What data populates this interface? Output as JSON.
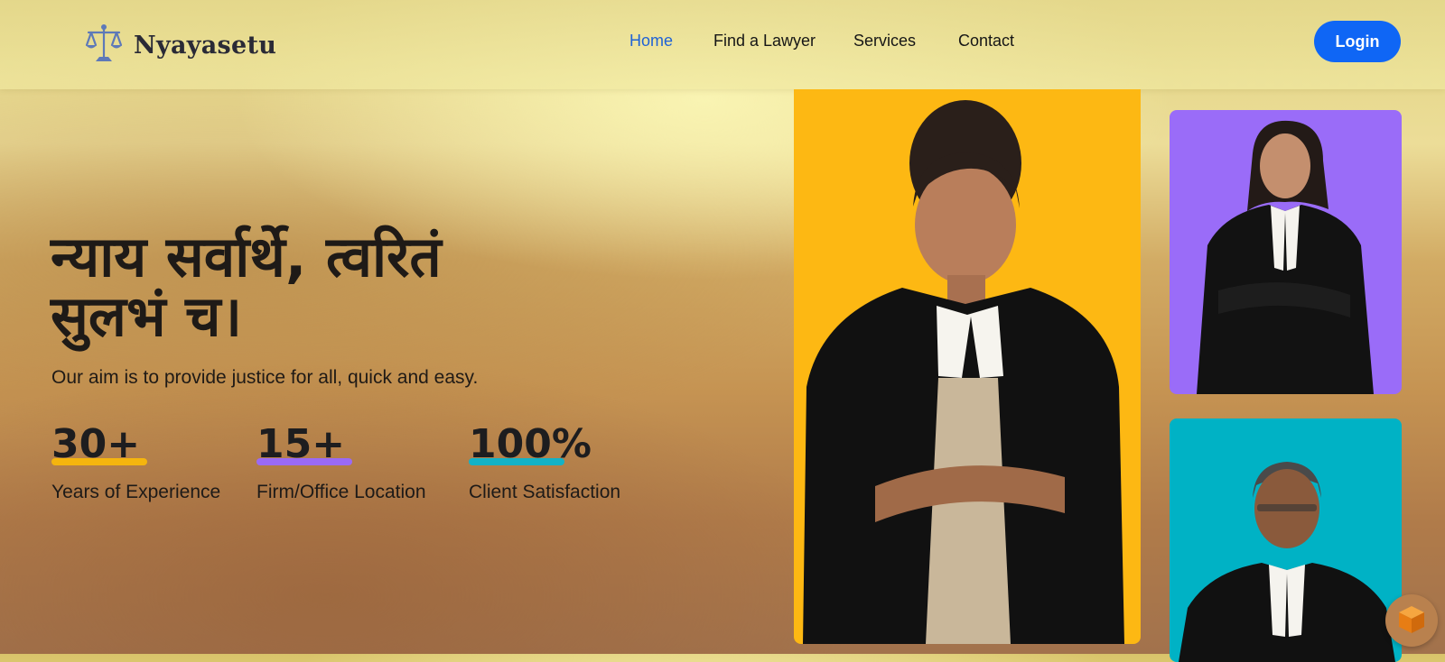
{
  "brand": {
    "name": "Nyayasetu",
    "logo_icon": "scales-of-justice-icon"
  },
  "nav": {
    "links": [
      {
        "label": "Home",
        "active": true
      },
      {
        "label": "Find a Lawyer",
        "active": false
      },
      {
        "label": "Services",
        "active": false
      },
      {
        "label": "Contact",
        "active": false
      }
    ],
    "login_label": "Login"
  },
  "hero": {
    "title_line1": "न्याय सर्वार्थे, त्वरितं",
    "title_line2": "सुलभं च।",
    "subtitle": "Our aim is to provide justice for all, quick and easy."
  },
  "stats": [
    {
      "value": "30+",
      "label": "Years of Experience",
      "underline_color": "#f5b50e"
    },
    {
      "value": "15+",
      "label": "Firm/Office Location",
      "underline_color": "#9a6af5"
    },
    {
      "value": "100%",
      "label": "Client Satisfaction",
      "underline_color": "#14b2c6"
    }
  ],
  "cards": [
    {
      "name": "lawyer-card-featured",
      "bg": "#fdb813"
    },
    {
      "name": "lawyer-card-purple",
      "bg": "#9a6cf8"
    },
    {
      "name": "lawyer-card-teal",
      "bg": "#00b2c5"
    }
  ],
  "colors": {
    "accent": "#0f66f5",
    "active_link": "#1f62d6",
    "fab_bg": "#b9814e",
    "fab_icon": "#f08a1c"
  },
  "floating_button_icon": "cube-icon"
}
